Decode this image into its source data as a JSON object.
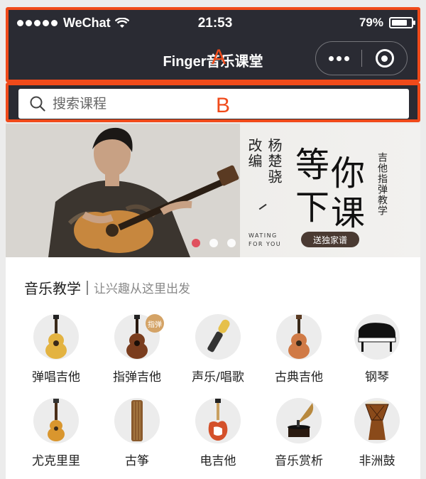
{
  "status_bar": {
    "carrier": "WeChat",
    "time": "21:53",
    "battery_percent": "79%",
    "battery_level": 0.79
  },
  "nav": {
    "title": "Finger音乐课堂",
    "marker": "A"
  },
  "search": {
    "placeholder": "搜索课程",
    "marker": "B"
  },
  "banner": {
    "line1": "改编",
    "line2": "杨楚骁",
    "headline_chars": [
      "等",
      "你",
      "下",
      "课"
    ],
    "side_text": "吉他指弹教学",
    "english_line1": "WATING",
    "english_line2": "FOR YOU",
    "button_label": "送独家谱",
    "slide_count": 3,
    "active_slide": 0
  },
  "section": {
    "title": "音乐教学",
    "subtitle": "让兴趣从这里出发"
  },
  "categories": [
    {
      "label": "弹唱吉他",
      "icon": "acoustic-guitar-icon"
    },
    {
      "label": "指弹吉他",
      "icon": "fingerstyle-guitar-icon",
      "badge": "指弹"
    },
    {
      "label": "声乐/唱歌",
      "icon": "microphone-icon"
    },
    {
      "label": "古典吉他",
      "icon": "classical-guitar-icon"
    },
    {
      "label": "钢琴",
      "icon": "piano-icon"
    },
    {
      "label": "尤克里里",
      "icon": "ukulele-icon"
    },
    {
      "label": "古筝",
      "icon": "guzheng-icon"
    },
    {
      "label": "电吉他",
      "icon": "electric-guitar-icon"
    },
    {
      "label": "音乐赏析",
      "icon": "gramophone-icon"
    },
    {
      "label": "非洲鼓",
      "icon": "djembe-icon"
    }
  ],
  "colors": {
    "header_bg": "#2a2b33",
    "annotation": "#f04a1a",
    "active_dot": "#e0505e",
    "badge": "#d4a366"
  }
}
